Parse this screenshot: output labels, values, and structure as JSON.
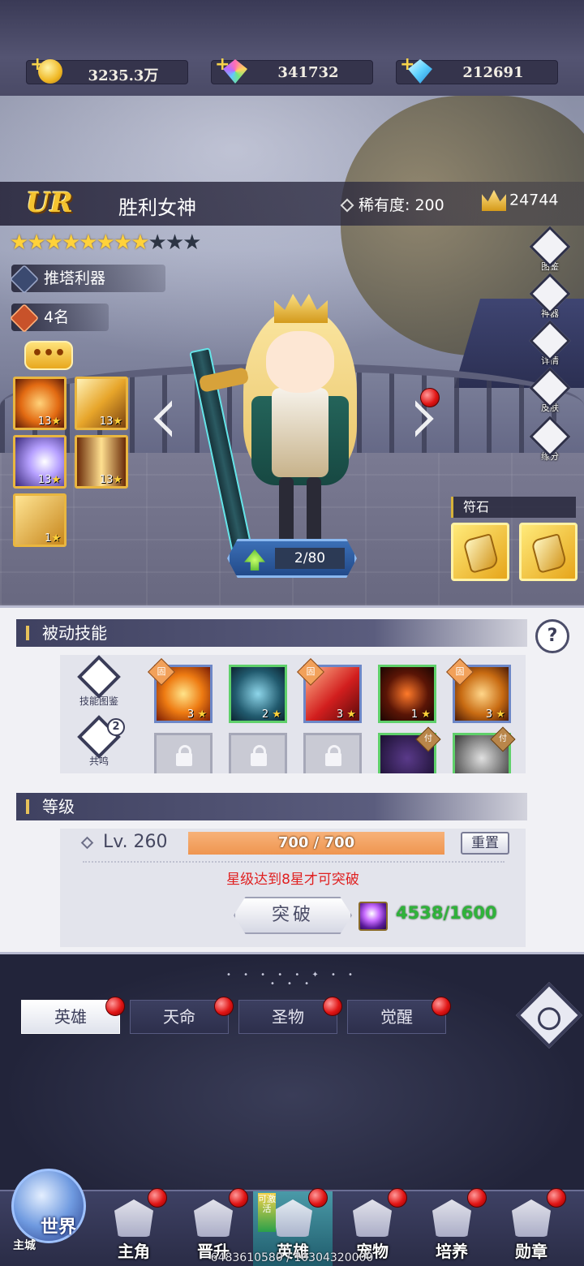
{
  "currencies": [
    {
      "icon": "gold-coin-icon",
      "value": "3235.3万"
    },
    {
      "icon": "rainbow-diamond-icon",
      "value": "341732"
    },
    {
      "icon": "blue-diamond-icon",
      "value": "212691"
    }
  ],
  "hero": {
    "grade": "UR",
    "name": "胜利女神",
    "rarity_label": "稀有度:",
    "rarity_value": "200",
    "power": "24744",
    "stars_filled": 8,
    "stars_total": 11,
    "role_tag": "推塔利器",
    "rank_tag": "4名"
  },
  "active_skills": [
    {
      "icon": "fire-burst-skill-icon",
      "level": "13"
    },
    {
      "icon": "golden-slash-skill-icon",
      "level": "13"
    },
    {
      "icon": "light-wave-skill-icon",
      "level": "13"
    },
    {
      "icon": "flame-pillar-skill-icon",
      "level": "13"
    },
    {
      "icon": "sword-skill-icon",
      "level": "1"
    }
  ],
  "side_menu": [
    {
      "label": "图鉴",
      "icon": "book-icon"
    },
    {
      "label": "神器",
      "icon": "artifact-icon"
    },
    {
      "label": "详情",
      "icon": "magnifier-icon"
    },
    {
      "label": "皮肤",
      "icon": "skin-icon"
    },
    {
      "label": "缘分",
      "icon": "heart-icon"
    }
  ],
  "runes": {
    "title": "符石"
  },
  "exp_items": "2/80",
  "passive": {
    "title": "被动技能",
    "help": "?",
    "side_buttons": [
      {
        "label": "技能图鉴",
        "icon": "skill-book-icon"
      },
      {
        "label": "共鸣",
        "icon": "resonance-icon",
        "badge": "2"
      }
    ],
    "fixed_label": "固",
    "skills": [
      {
        "icon": "fire-slash-passive-icon",
        "level": "3",
        "fixed": true
      },
      {
        "icon": "ice-vortex-passive-icon",
        "level": "2",
        "fixed": false
      },
      {
        "icon": "red-sword-passive-icon",
        "level": "3",
        "fixed": true
      },
      {
        "icon": "dark-flame-passive-icon",
        "level": "1",
        "fixed": false
      },
      {
        "icon": "golden-claw-passive-icon",
        "level": "3",
        "fixed": true
      }
    ],
    "bottom_mark": "付"
  },
  "level": {
    "title": "等级",
    "label": "Lv. 260",
    "xp_text": "700 / 700",
    "xp_fraction": 1.0,
    "reset_label": "重置",
    "warning": "星级达到8星才可突破",
    "break_label": "突破",
    "material_count": "4538/1600"
  },
  "tabs": [
    {
      "label": "英雄",
      "active": true
    },
    {
      "label": "天命",
      "active": false
    },
    {
      "label": "圣物",
      "active": false
    },
    {
      "label": "觉醒",
      "active": false
    }
  ],
  "deco_line": "• • • • • ✦ • • • • •",
  "nav": {
    "world_label": "世界",
    "world_sub": "主城",
    "activate_badge": "可激活",
    "items": [
      {
        "label": "主角",
        "icon": "protagonist-icon"
      },
      {
        "label": "晋升",
        "icon": "promotion-icon"
      },
      {
        "label": "英雄",
        "icon": "hero-icon",
        "active": true
      },
      {
        "label": "宠物",
        "icon": "pet-icon"
      },
      {
        "label": "培养",
        "icon": "training-icon"
      },
      {
        "label": "勋章",
        "icon": "medal-icon"
      }
    ]
  },
  "footer": "6483610580 / 10304320000"
}
